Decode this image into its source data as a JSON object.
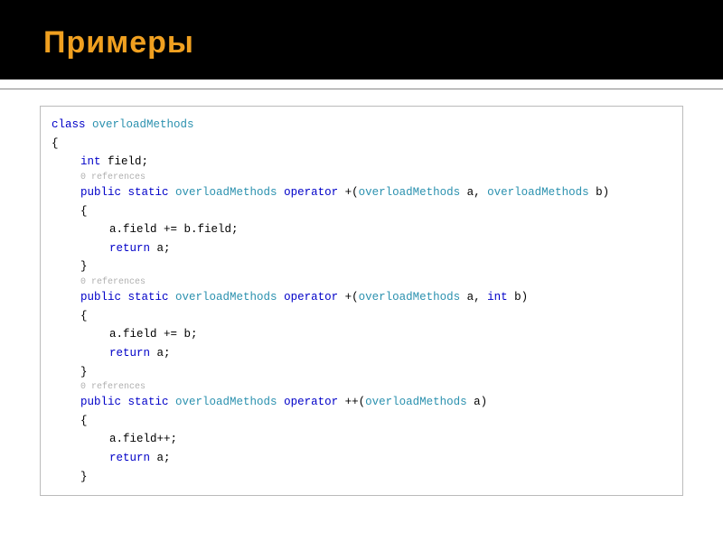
{
  "title": "Примеры",
  "code": {
    "class_kw": "class",
    "class_name": "overloadMethods",
    "brace_open": "{",
    "field_kw": "int",
    "field_name": " field;",
    "ref_text": "0 references",
    "sig1_pre": "public static ",
    "sig1_type": "overloadMethods",
    "sig1_op_kw": " operator ",
    "sig1_op": "+(",
    "sig1_p1t": "overloadMethods",
    "sig1_p1n": " a, ",
    "sig1_p2t": "overloadMethods",
    "sig1_p2n": " b)",
    "body1_l1": "a.field += b.field;",
    "body1_ret_kw": "return",
    "body1_ret": " a;",
    "sig2_pre": "public static ",
    "sig2_type": "overloadMethods",
    "sig2_op_kw": " operator ",
    "sig2_op": "+(",
    "sig2_p1t": "overloadMethods",
    "sig2_p1n": " a, ",
    "sig2_p2t": "int",
    "sig2_p2n": " b)",
    "body2_l1": "a.field += b;",
    "body2_ret_kw": "return",
    "body2_ret": " a;",
    "sig3_pre": "public static ",
    "sig3_type": "overloadMethods",
    "sig3_op_kw": " operator ",
    "sig3_op": "++(",
    "sig3_p1t": "overloadMethods",
    "sig3_p1n": " a)",
    "body3_l1": "a.field++;",
    "body3_ret_kw": "return",
    "body3_ret": " a;",
    "brace_close": "}"
  }
}
